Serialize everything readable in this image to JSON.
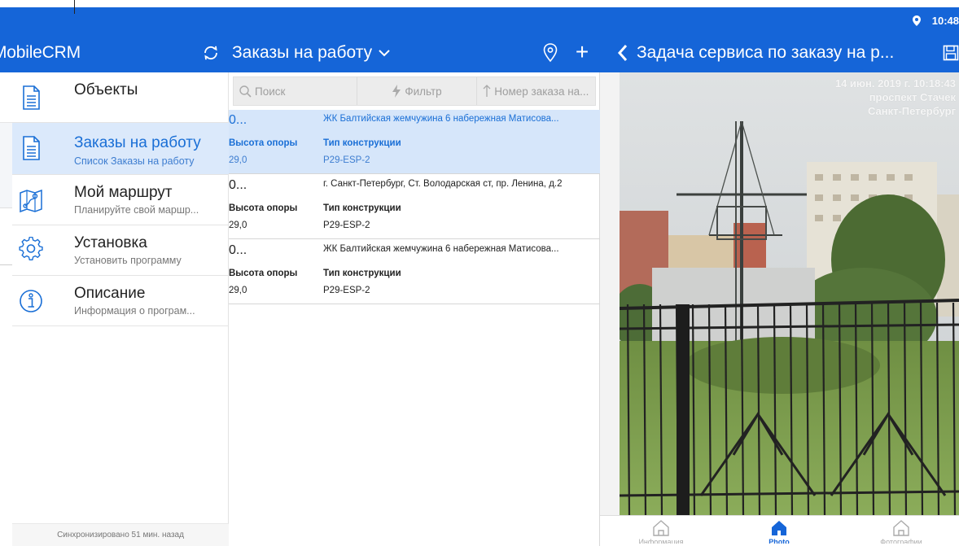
{
  "status_bar": {
    "time": "10:48"
  },
  "app_bar": {
    "app_title": "MobileCRM",
    "list_title": "Заказы на работу",
    "detail_title": "Задача сервиса по заказу на р..."
  },
  "menu": {
    "items": [
      {
        "title": "Объекты",
        "subtitle": ""
      },
      {
        "title": "Заказы на работу",
        "subtitle": "Список Заказы на работу"
      },
      {
        "title": "Мой маршрут",
        "subtitle": "Планируйте свой маршр..."
      },
      {
        "title": "Установка",
        "subtitle": "Установить программу"
      },
      {
        "title": "Описание",
        "subtitle": "Информация о програм..."
      }
    ],
    "sync_text": "Синхронизировано 51 мин. назад"
  },
  "list": {
    "search_label": "Поиск",
    "filter_label": "Фильтр",
    "sort_label": "Номер заказа на...",
    "rows": [
      {
        "num": "0...",
        "address": "ЖК Балтийская жемчужина 6 набережная Матисова...",
        "label1": "Высота опоры",
        "value1": "29,0",
        "label2": "Тип конструкции",
        "value2": "P29-ESP-2"
      },
      {
        "num": "0...",
        "address": "г. Санкт-Петербург, Ст. Володарская ст, пр. Ленина, д.2",
        "label1": "Высота опоры",
        "value1": "29,0",
        "label2": "Тип конструкции",
        "value2": "P29-ESP-2"
      },
      {
        "num": "0...",
        "address": "ЖК Балтийская жемчужина 6 набережная Матисова...",
        "label1": "Высота опоры",
        "value1": "29,0",
        "label2": "Тип конструкции",
        "value2": "P29-ESP-2"
      }
    ]
  },
  "photo": {
    "stamp_date": "14 июн. 2019 г. 10:18:43",
    "stamp_street": "проспект Стачек",
    "stamp_city": "Санкт-Петербург"
  },
  "bottom_nav": {
    "items": [
      {
        "label": "Информация",
        "icon": "home-outline-icon"
      },
      {
        "label": "Photo",
        "icon": "home-filled-icon"
      },
      {
        "label": "Фотографии",
        "icon": "home-outline-icon"
      }
    ]
  },
  "colors": {
    "primary": "#1565d8",
    "active_row": "#d6e6fa",
    "active_text": "#1a6fd6"
  }
}
